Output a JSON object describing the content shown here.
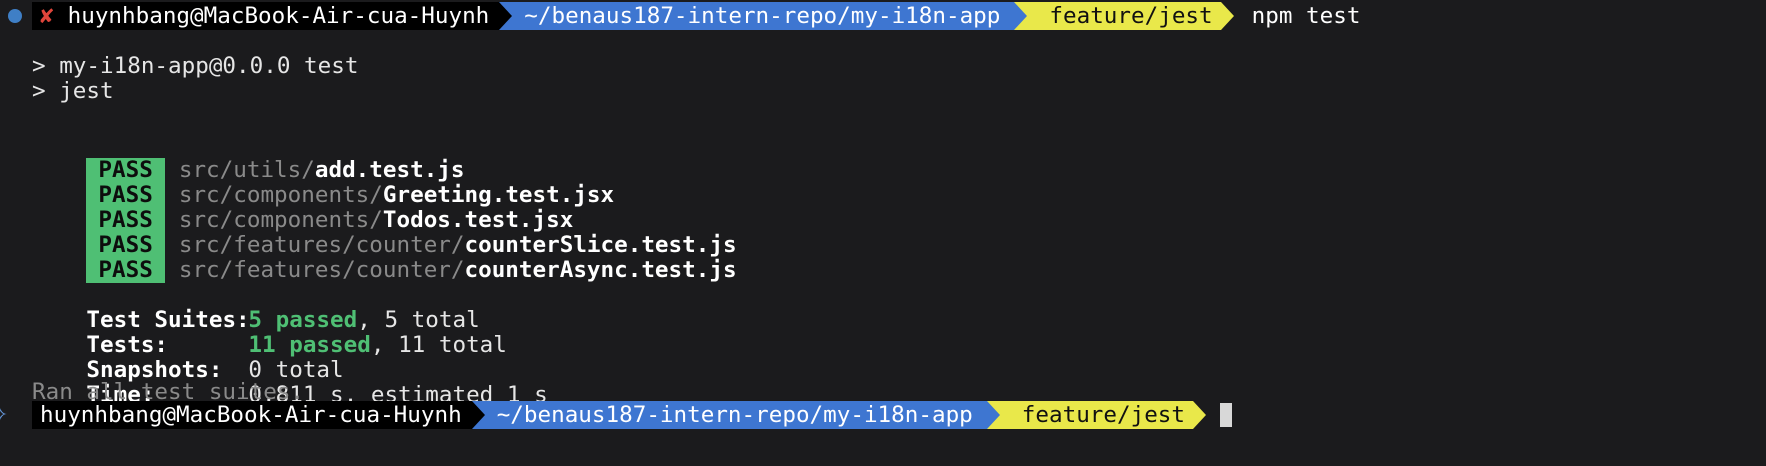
{
  "prompt": {
    "error_glyph": "✘",
    "user": "huynhbang@MacBook-Air-cua-Huynh",
    "dir": "~/benaus187-intern-repo/my-i18n-app",
    "branch_glyph": "",
    "branch": "feature/jest",
    "command": "npm test"
  },
  "script_header": [
    "> my-i18n-app@0.0.0 test",
    "> jest"
  ],
  "pass_label": "PASS",
  "results": [
    {
      "dir": "src/utils/",
      "file": "add.test.js"
    },
    {
      "dir": "src/components/",
      "file": "Greeting.test.jsx"
    },
    {
      "dir": "src/components/",
      "file": "Todos.test.jsx"
    },
    {
      "dir": "src/features/counter/",
      "file": "counterSlice.test.js"
    },
    {
      "dir": "src/features/counter/",
      "file": "counterAsync.test.js"
    }
  ],
  "summary": {
    "suites_label": "Test Suites:",
    "suites_passed": "5 passed",
    "suites_total": ", 5 total",
    "tests_label": "Tests:",
    "tests_passed": "11 passed",
    "tests_total": ", 11 total",
    "snapshots_label": "Snapshots:",
    "snapshots_value": "0 total",
    "time_label": "Time:",
    "time_value": "0.811 s, estimated 1 s",
    "footer": "Ran all test suites."
  },
  "colors": {
    "background": "#1b1b1d",
    "user_segment": "#000000",
    "dir_segment": "#3e76d1",
    "git_segment": "#e9e84a",
    "pass_badge": "#4fbf74",
    "error": "#e0453b"
  }
}
